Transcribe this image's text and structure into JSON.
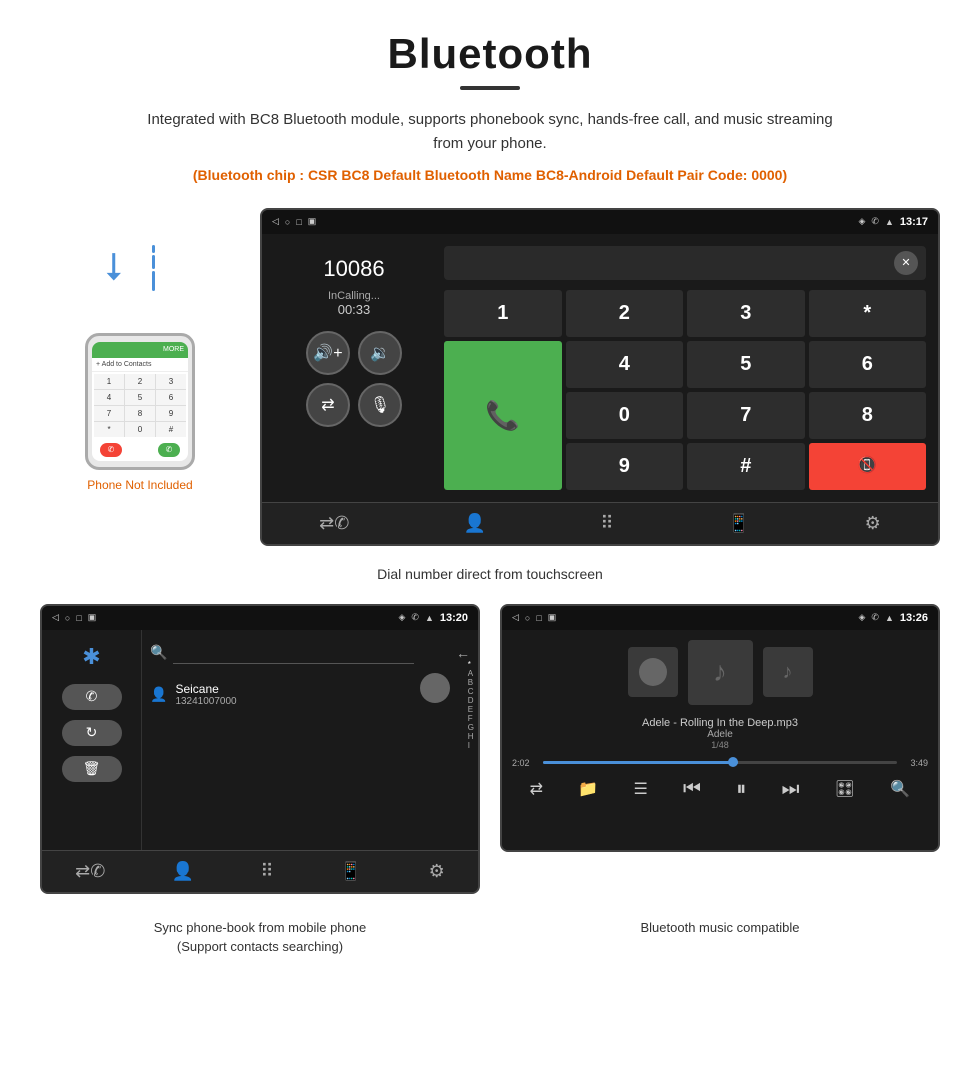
{
  "page": {
    "title": "Bluetooth",
    "title_underline": true,
    "description": "Integrated with BC8 Bluetooth module, supports phonebook sync, hands-free call, and music streaming from your phone.",
    "spec_text": "(Bluetooth chip : CSR BC8    Default Bluetooth Name BC8-Android    Default Pair Code: 0000)",
    "dial_caption": "Dial number direct from touchscreen",
    "phonebook_caption": "Sync phone-book from mobile phone\n(Support contacts searching)",
    "music_caption": "Bluetooth music compatible",
    "phone_not_included": "Phone Not Included"
  },
  "statusbar": {
    "time_dial": "13:17",
    "time_phonebook": "13:20",
    "time_music": "13:26",
    "back_icon": "◁",
    "home_icon": "○",
    "recent_icon": "□",
    "location_icon": "⬦",
    "signal_icon": "📶"
  },
  "dial_screen": {
    "number": "10086",
    "status": "InCalling...",
    "timer": "00:33",
    "keys": [
      "1",
      "2",
      "3",
      "*",
      "4",
      "5",
      "6",
      "0",
      "7",
      "8",
      "9",
      "#"
    ],
    "call_icon": "📞",
    "end_icon": "📵"
  },
  "phonebook_screen": {
    "contact_name": "Seicane",
    "contact_number": "13241007000",
    "alphabet": [
      "*",
      "A",
      "B",
      "C",
      "D",
      "E",
      "F",
      "G",
      "H",
      "I"
    ]
  },
  "music_screen": {
    "track_name": "Adele - Rolling In the Deep.mp3",
    "artist": "Adele",
    "track_count": "1/48",
    "time_current": "2:02",
    "time_total": "3:49",
    "progress_percent": 55
  },
  "navbar_icons": {
    "phone_transfer": "📲",
    "contacts": "👤",
    "dialpad": "⠿",
    "sms": "💬",
    "settings": "⚙"
  }
}
